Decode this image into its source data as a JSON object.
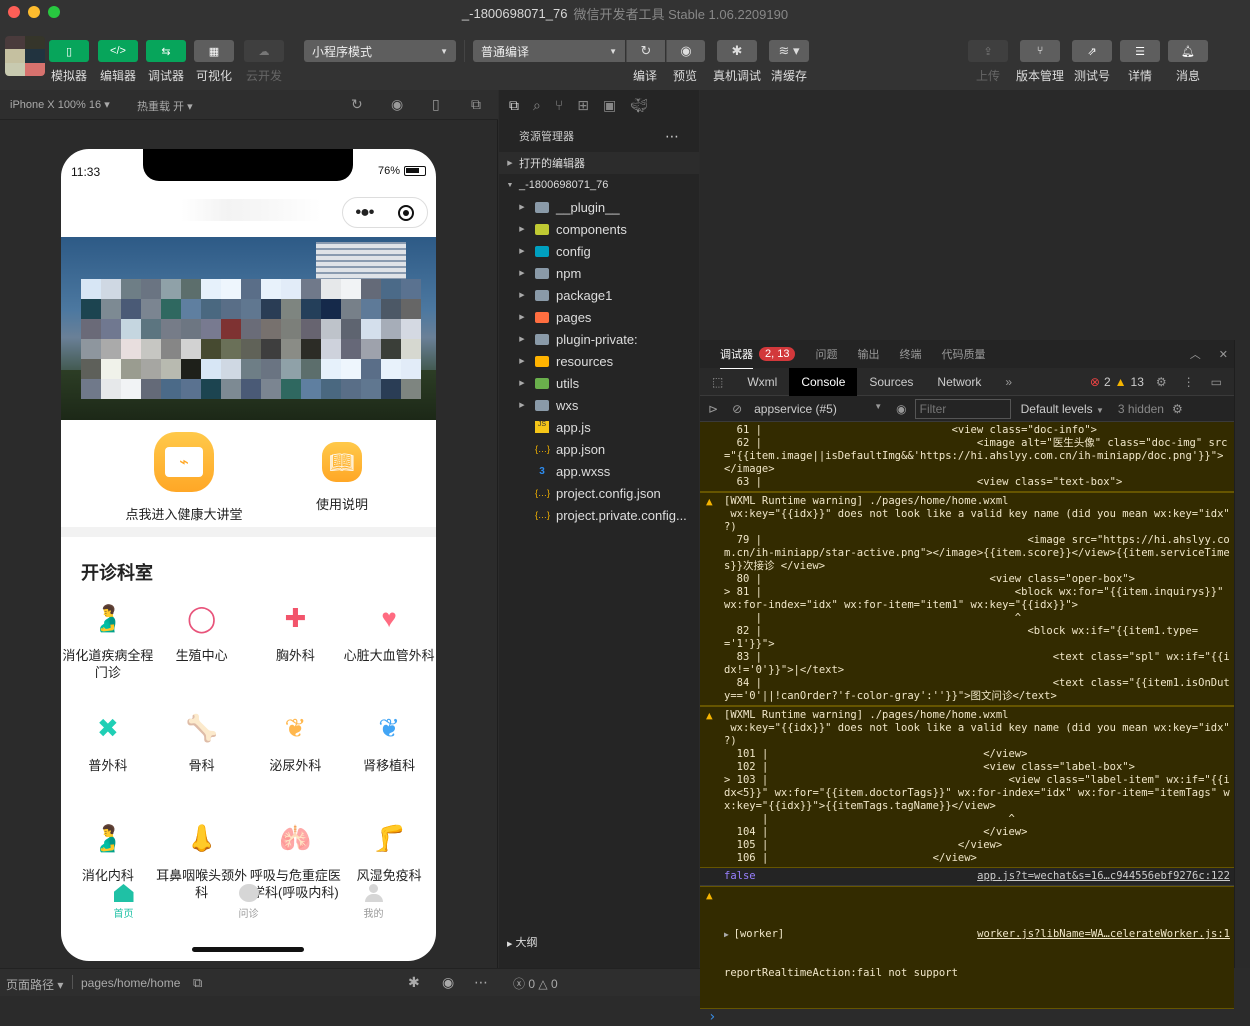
{
  "window": {
    "project": "_-1800698071_76",
    "separator": " - ",
    "app_name": "微信开发者工具 Stable 1.06.2209190",
    "traffic_colors": [
      "#fe5f57",
      "#febc2e",
      "#28c840"
    ]
  },
  "toolbar": {
    "left_buttons": [
      {
        "label": "模拟器",
        "icon": "phone-icon",
        "style": "green"
      },
      {
        "label": "编辑器",
        "icon": "code-icon",
        "style": "green"
      },
      {
        "label": "调试器",
        "icon": "sliders-icon",
        "style": "green"
      },
      {
        "label": "可视化",
        "icon": "layout-icon",
        "style": "gray"
      },
      {
        "label": "云开发",
        "icon": "cloud-icon",
        "style": "disabled"
      }
    ],
    "mode_select": "小程序模式",
    "compile_select": "普通编译",
    "middle_buttons": [
      {
        "label": "编译",
        "icon": "refresh-icon"
      },
      {
        "label": "预览",
        "icon": "eye-icon"
      },
      {
        "label": "真机调试",
        "icon": "bug-icon"
      },
      {
        "label": "清缓存",
        "icon": "layers-icon"
      }
    ],
    "right_buttons": [
      {
        "label": "上传",
        "icon": "upload-icon",
        "disabled": true
      },
      {
        "label": "版本管理",
        "icon": "branch-icon"
      },
      {
        "label": "测试号",
        "icon": "external-icon"
      },
      {
        "label": "详情",
        "icon": "menu-icon"
      },
      {
        "label": "消息",
        "icon": "bell-icon"
      }
    ]
  },
  "simulator_bar": {
    "device": "iPhone X 100% 16",
    "hot_reload": "热重载 开"
  },
  "phone": {
    "time": "11:33",
    "battery": "76%",
    "quick_entries": [
      {
        "label": "点我进入健康大讲堂",
        "icon": "monitor-pulse-icon"
      },
      {
        "label": "使用说明",
        "icon": "book-icon"
      }
    ],
    "section_title": "开诊科室",
    "departments": [
      {
        "label": "消化道疾病全程门诊",
        "icon": "stomach-icon",
        "glyph": "🫃",
        "color": "#ff7a59"
      },
      {
        "label": "生殖中心",
        "icon": "ring-icon",
        "glyph": "◯",
        "color": "#e8537a"
      },
      {
        "label": "胸外科",
        "icon": "hospital-sign-icon",
        "glyph": "✚",
        "color": "#f2546b"
      },
      {
        "label": "心脏大血管外科",
        "icon": "heart-icon",
        "glyph": "♥",
        "color": "#ff6b81"
      },
      {
        "label": "普外科",
        "icon": "bandage-icon",
        "glyph": "✖",
        "color": "#1fcfb5"
      },
      {
        "label": "骨科",
        "icon": "bone-icon",
        "glyph": "🦴",
        "color": "#ff8a65"
      },
      {
        "label": "泌尿外科",
        "icon": "kidney-icon",
        "glyph": "❦",
        "color": "#ffb74d"
      },
      {
        "label": "肾移植科",
        "icon": "kidney-blue-icon",
        "glyph": "❦",
        "color": "#42a5f5"
      },
      {
        "label": "消化内科",
        "icon": "stomach-icon",
        "glyph": "🫃",
        "color": "#ff7a59"
      },
      {
        "label": "耳鼻咽喉头颈外科",
        "icon": "nose-icon",
        "glyph": "👃",
        "color": "#ffcc99"
      },
      {
        "label": "呼吸与危重症医学科(呼吸内科)",
        "icon": "lungs-icon",
        "glyph": "🫁",
        "color": "#1fcfb5"
      },
      {
        "label": "风湿免疫科",
        "icon": "joint-icon",
        "glyph": "🦵",
        "color": "#ff6b81"
      }
    ],
    "tabs": [
      {
        "label": "首页",
        "icon": "home-icon",
        "active": true
      },
      {
        "label": "问诊",
        "icon": "chat-icon",
        "active": false
      },
      {
        "label": "我的",
        "icon": "user-icon",
        "active": false
      }
    ],
    "accent": "#1fc1a5"
  },
  "bottom_bar": {
    "path_label": "页面路径",
    "path": "pages/home/home"
  },
  "explorer": {
    "title": "资源管理器",
    "open_editors": "打开的编辑器",
    "root": "_-1800698071_76",
    "items": [
      {
        "name": "__plugin__",
        "type": "folder",
        "color": "#8a9aa8"
      },
      {
        "name": "components",
        "type": "folder",
        "color": "#c0ca33"
      },
      {
        "name": "config",
        "type": "folder",
        "color": "#00a0c0"
      },
      {
        "name": "npm",
        "type": "folder",
        "color": "#8a9aa8"
      },
      {
        "name": "package1",
        "type": "folder",
        "color": "#8a9aa8"
      },
      {
        "name": "pages",
        "type": "folder",
        "color": "#ff6e40"
      },
      {
        "name": "plugin-private:",
        "type": "folder",
        "color": "#8a9aa8"
      },
      {
        "name": "resources",
        "type": "folder",
        "color": "#ffb300"
      },
      {
        "name": "utils",
        "type": "folder",
        "color": "#6ab04c"
      },
      {
        "name": "wxs",
        "type": "folder",
        "color": "#8a9aa8"
      },
      {
        "name": "app.js",
        "type": "js"
      },
      {
        "name": "app.json",
        "type": "json"
      },
      {
        "name": "app.wxss",
        "type": "css"
      },
      {
        "name": "project.config.json",
        "type": "json"
      },
      {
        "name": "project.private.config...",
        "type": "json"
      }
    ],
    "outline": "大纲",
    "errors": "0",
    "warnings": "0"
  },
  "devtools": {
    "tabs": [
      "调试器",
      "问题",
      "输出",
      "终端",
      "代码质量"
    ],
    "badge": "2, 13",
    "panels": [
      "Wxml",
      "Console",
      "Sources",
      "Network"
    ],
    "error_count": "2",
    "warning_count": "13",
    "context": "appservice (#5)",
    "filter_placeholder": "Filter",
    "levels": "Default levels",
    "hidden": "3 hidden",
    "console": {
      "block1": "  61 |                              <view class=\"doc-info\">\n  62 |                                  <image alt=\"医生头像\" class=\"doc-img\" src=\"{{item.image||isDefaultImg&&'https://hi.ahslyy.com.cn/ih-miniapp/doc.png'}}\"></image>\n  63 |                                  <view class=\"text-box\">",
      "warn1": "[WXML Runtime warning] ./pages/home/home.wxml\n wx:key=\"{{idx}}\" does not look like a valid key name (did you mean wx:key=\"idx\" ?)\n  79 |                                          <image src=\"https://hi.ahslyy.com.cn/ih-miniapp/star-active.png\"></image>{{item.score}}</view>{{item.serviceTimes}}次接诊 </view>\n  80 |                                    <view class=\"oper-box\">\n> 81 |                                        <block wx:for=\"{{item.inquirys}}\" wx:for-index=\"idx\" wx:for-item=\"item1\" wx:key=\"{{idx}}\">\n     |                                        ^\n  82 |                                          <block wx:if=\"{{item1.type=='1'}}\">\n  83 |                                              <text class=\"spl\" wx:if=\"{{idx!='0'}}\">|</text>\n  84 |                                              <text class=\"{{item1.isOnDuty=='0'||!canOrder?'f-color-gray':''}}\">图文问诊</text>",
      "warn2": "[WXML Runtime warning] ./pages/home/home.wxml\n wx:key=\"{{idx}}\" does not look like a valid key name (did you mean wx:key=\"idx\" ?)\n  101 |                                  </view>\n  102 |                                  <view class=\"label-box\">\n> 103 |                                      <view class=\"label-item\" wx:if=\"{{idx<5}}\" wx:for=\"{{item.doctorTags}}\" wx:for-index=\"idx\" wx:for-item=\"itemTags\" wx:key=\"{{idx}}\">{{itemTags.tagName}}</view>\n      |                                      ^\n  104 |                                  </view>\n  105 |                              </view>\n  106 |                          </view>",
      "false_value": "false",
      "false_source": "app.js?t=wechat&s=16…c944556ebf9276c:122",
      "worker_label": "[worker]",
      "worker_source": "worker.js?libName=WA…celerateWorker.js:1",
      "worker_msg": "reportRealtimeAction:fail not support",
      "prompt": "›"
    }
  }
}
